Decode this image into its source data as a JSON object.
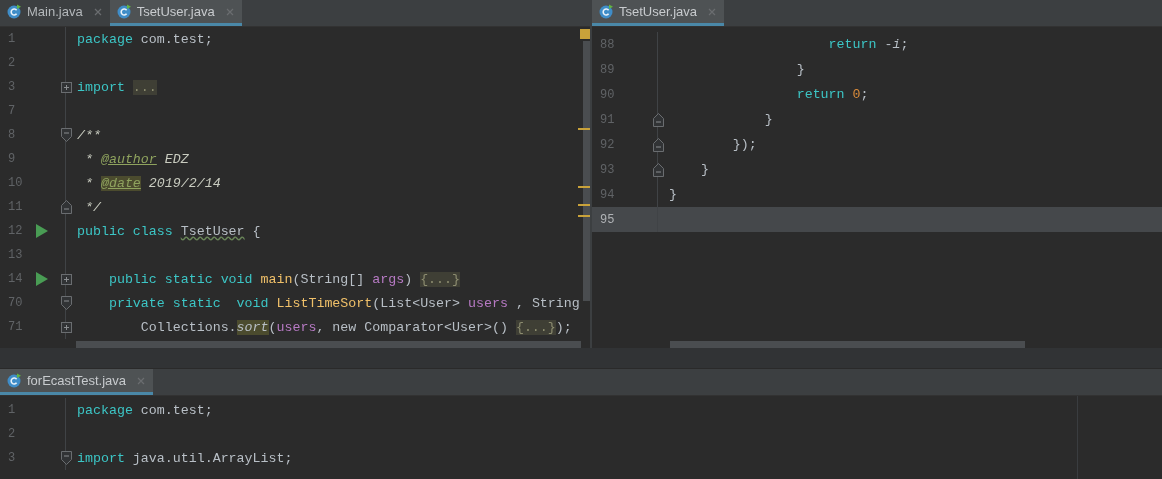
{
  "top_left_pane": {
    "tabs": [
      {
        "label": "Main.java",
        "selected": false
      },
      {
        "label": "TsetUser.java",
        "selected": true
      }
    ],
    "lines": [
      {
        "number": "1",
        "run": false,
        "current": false,
        "tokens": [
          {
            "kind": "keyword",
            "text": "package"
          },
          {
            "kind": "plain",
            "text": " com.test;"
          }
        ]
      },
      {
        "number": "2",
        "run": false,
        "current": false
      },
      {
        "number": "3",
        "run": false,
        "current": false,
        "fold": {
          "kind": "expand"
        },
        "tokens": [
          {
            "kind": "keyword",
            "text": "import "
          },
          {
            "kind": "folded",
            "text": "..."
          }
        ]
      },
      {
        "number": "7",
        "run": false,
        "current": false
      },
      {
        "number": "8",
        "run": false,
        "current": false,
        "fold": {
          "kind": "collapse"
        },
        "tokens": [
          {
            "kind": "comment",
            "text": "/**"
          }
        ]
      },
      {
        "number": "9",
        "run": false,
        "current": false,
        "tokens": [
          {
            "kind": "comment",
            "text": " * "
          },
          {
            "kind": "doctag",
            "text": "@author"
          },
          {
            "kind": "comment",
            "text": " EDZ"
          }
        ]
      },
      {
        "number": "10",
        "run": false,
        "current": false,
        "tokens": [
          {
            "kind": "comment",
            "text": " * "
          },
          {
            "kind": "doctag-highlight",
            "text": "@date"
          },
          {
            "kind": "comment",
            "text": " 2019/2/14"
          }
        ]
      },
      {
        "number": "11",
        "run": false,
        "current": false,
        "fold": {
          "kind": "end"
        },
        "tokens": [
          {
            "kind": "comment",
            "text": " */"
          }
        ]
      },
      {
        "number": "12",
        "run": true,
        "current": false,
        "tokens": [
          {
            "kind": "keyword",
            "text": "public class "
          },
          {
            "kind": "typo",
            "text": "TsetUser"
          },
          {
            "kind": "plain",
            "text": " {"
          }
        ]
      },
      {
        "number": "13",
        "run": false,
        "current": false
      },
      {
        "number": "14",
        "run": true,
        "current": false,
        "fold": {
          "kind": "expand"
        },
        "tokens": [
          {
            "kind": "keyword",
            "text": "    public static void "
          },
          {
            "kind": "method",
            "text": "main"
          },
          {
            "kind": "plain",
            "text": "(String[] "
          },
          {
            "kind": "param",
            "text": "args"
          },
          {
            "kind": "plain",
            "text": ") "
          },
          {
            "kind": "folded",
            "text": "{...}"
          }
        ]
      },
      {
        "number": "70",
        "run": false,
        "current": false,
        "fold": {
          "kind": "collapse"
        },
        "tokens": [
          {
            "kind": "keyword",
            "text": "    private static  void "
          },
          {
            "kind": "method",
            "text": "ListTimeSort"
          },
          {
            "kind": "plain",
            "text": "(List<User> "
          },
          {
            "kind": "param",
            "text": "users"
          },
          {
            "kind": "plain",
            "text": " , String"
          }
        ]
      },
      {
        "number": "71",
        "run": false,
        "current": false,
        "fold": {
          "kind": "expand"
        },
        "tokens": [
          {
            "kind": "plain",
            "text": "        Collections."
          },
          {
            "kind": "usage",
            "text": "sort"
          },
          {
            "kind": "plain",
            "text": "("
          },
          {
            "kind": "param",
            "text": "users"
          },
          {
            "kind": "plain",
            "text": ", new Comparator<User>() "
          },
          {
            "kind": "folded",
            "text": "{...}"
          },
          {
            "kind": "plain",
            "text": ");"
          }
        ]
      }
    ]
  },
  "top_right_pane": {
    "tabs": [
      {
        "label": "TsetUser.java",
        "selected": true
      }
    ],
    "lines": [
      {
        "number": "88",
        "run": false,
        "current": false,
        "tokens": [
          {
            "kind": "keyword",
            "text": "                    return"
          },
          {
            "kind": "plain",
            "text": " -"
          },
          {
            "kind": "local",
            "text": "i"
          },
          {
            "kind": "plain",
            "text": ";"
          }
        ]
      },
      {
        "number": "89",
        "run": false,
        "current": false,
        "tokens": [
          {
            "kind": "plain",
            "text": "                }"
          }
        ]
      },
      {
        "number": "90",
        "run": false,
        "current": false,
        "tokens": [
          {
            "kind": "keyword",
            "text": "                return "
          },
          {
            "kind": "number",
            "text": "0"
          },
          {
            "kind": "plain",
            "text": ";"
          }
        ]
      },
      {
        "number": "91",
        "run": false,
        "current": false,
        "fold": {
          "kind": "end"
        },
        "tokens": [
          {
            "kind": "plain",
            "text": "            }"
          }
        ]
      },
      {
        "number": "92",
        "run": false,
        "current": false,
        "fold": {
          "kind": "end"
        },
        "tokens": [
          {
            "kind": "plain",
            "text": "        });"
          }
        ]
      },
      {
        "number": "93",
        "run": false,
        "current": false,
        "fold": {
          "kind": "end"
        },
        "tokens": [
          {
            "kind": "plain",
            "text": "    }"
          }
        ]
      },
      {
        "number": "94",
        "run": false,
        "current": false,
        "tokens": [
          {
            "kind": "plain",
            "text": "}"
          }
        ]
      },
      {
        "number": "95",
        "run": false,
        "current": true
      }
    ]
  },
  "bottom_pane": {
    "tabs": [
      {
        "label": "forEcastTest.java",
        "selected": true
      }
    ],
    "lines": [
      {
        "number": "1",
        "run": false,
        "current": false,
        "tokens": [
          {
            "kind": "keyword",
            "text": "package"
          },
          {
            "kind": "plain",
            "text": " com.test;"
          }
        ]
      },
      {
        "number": "2",
        "run": false,
        "current": false
      },
      {
        "number": "3",
        "run": false,
        "current": false,
        "fold": {
          "kind": "collapse"
        },
        "tokens": [
          {
            "kind": "keyword",
            "text": "import"
          },
          {
            "kind": "plain",
            "text": " java.util.ArrayList;"
          }
        ]
      }
    ]
  }
}
